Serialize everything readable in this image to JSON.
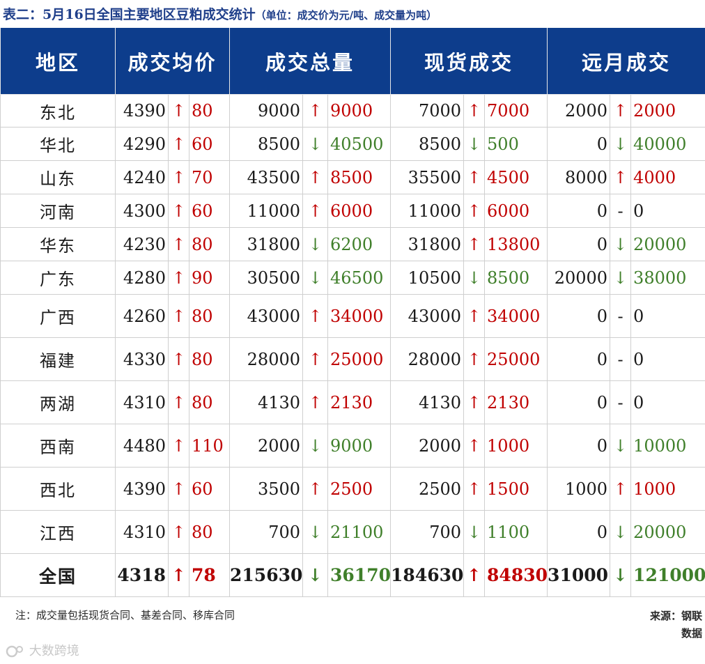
{
  "title": {
    "main": "表二：5月16日全国主要地区豆粕成交统计",
    "unit": "（单位：成交价为元/吨、成交量为吨）"
  },
  "headers": [
    "地区",
    "成交均价",
    "成交总量",
    "现货成交",
    "远月成交"
  ],
  "rows": [
    {
      "region": "东北",
      "cells": [
        [
          "4390",
          "up",
          "80"
        ],
        [
          "9000",
          "up",
          "9000"
        ],
        [
          "7000",
          "up",
          "7000"
        ],
        [
          "2000",
          "up",
          "2000"
        ]
      ]
    },
    {
      "region": "华北",
      "cells": [
        [
          "4290",
          "up",
          "60"
        ],
        [
          "8500",
          "down",
          "40500"
        ],
        [
          "8500",
          "down",
          "500"
        ],
        [
          "0",
          "down",
          "40000"
        ]
      ]
    },
    {
      "region": "山东",
      "cells": [
        [
          "4240",
          "up",
          "70"
        ],
        [
          "43500",
          "up",
          "8500"
        ],
        [
          "35500",
          "up",
          "4500"
        ],
        [
          "8000",
          "up",
          "4000"
        ]
      ]
    },
    {
      "region": "河南",
      "cells": [
        [
          "4300",
          "up",
          "60"
        ],
        [
          "11000",
          "up",
          "6000"
        ],
        [
          "11000",
          "up",
          "6000"
        ],
        [
          "0",
          "flat",
          "0"
        ]
      ]
    },
    {
      "region": "华东",
      "cells": [
        [
          "4230",
          "up",
          "80"
        ],
        [
          "31800",
          "down",
          "6200"
        ],
        [
          "31800",
          "up",
          "13800"
        ],
        [
          "0",
          "down",
          "20000"
        ]
      ]
    },
    {
      "region": "广东",
      "cells": [
        [
          "4280",
          "up",
          "90"
        ],
        [
          "30500",
          "down",
          "46500"
        ],
        [
          "10500",
          "down",
          "8500"
        ],
        [
          "20000",
          "down",
          "38000"
        ]
      ]
    },
    {
      "region": "广西",
      "cells": [
        [
          "4260",
          "up",
          "80"
        ],
        [
          "43000",
          "up",
          "34000"
        ],
        [
          "43000",
          "up",
          "34000"
        ],
        [
          "0",
          "flat",
          "0"
        ]
      ]
    },
    {
      "region": "福建",
      "cells": [
        [
          "4330",
          "up",
          "80"
        ],
        [
          "28000",
          "up",
          "25000"
        ],
        [
          "28000",
          "up",
          "25000"
        ],
        [
          "0",
          "flat",
          "0"
        ]
      ]
    },
    {
      "region": "两湖",
      "cells": [
        [
          "4310",
          "up",
          "80"
        ],
        [
          "4130",
          "up",
          "2130"
        ],
        [
          "4130",
          "up",
          "2130"
        ],
        [
          "0",
          "flat",
          "0"
        ]
      ]
    },
    {
      "region": "西南",
      "cells": [
        [
          "4480",
          "up",
          "110"
        ],
        [
          "2000",
          "down",
          "9000"
        ],
        [
          "2000",
          "up",
          "1000"
        ],
        [
          "0",
          "down",
          "10000"
        ]
      ]
    },
    {
      "region": "西北",
      "cells": [
        [
          "4390",
          "up",
          "60"
        ],
        [
          "3500",
          "up",
          "2500"
        ],
        [
          "2500",
          "up",
          "1500"
        ],
        [
          "1000",
          "up",
          "1000"
        ]
      ]
    },
    {
      "region": "江西",
      "cells": [
        [
          "4310",
          "up",
          "80"
        ],
        [
          "700",
          "down",
          "21100"
        ],
        [
          "700",
          "down",
          "1100"
        ],
        [
          "0",
          "down",
          "20000"
        ]
      ]
    },
    {
      "region": "全国",
      "cells": [
        [
          "4318",
          "up",
          "78"
        ],
        [
          "215630",
          "down",
          "36170"
        ],
        [
          "184630",
          "up",
          "84830"
        ],
        [
          "31000",
          "down",
          "121000"
        ]
      ]
    }
  ],
  "arrows": {
    "up": "↑",
    "down": "↓",
    "flat": "-"
  },
  "colors": {
    "header_bg": "#0d3d8c",
    "up": "#c00000",
    "down": "#3f7f2a",
    "title": "#1f3f8a"
  },
  "note": "注：成交量包括现货合同、基差合同、移库合同",
  "source": "来源：钢联数据",
  "watermark": "大数跨境"
}
